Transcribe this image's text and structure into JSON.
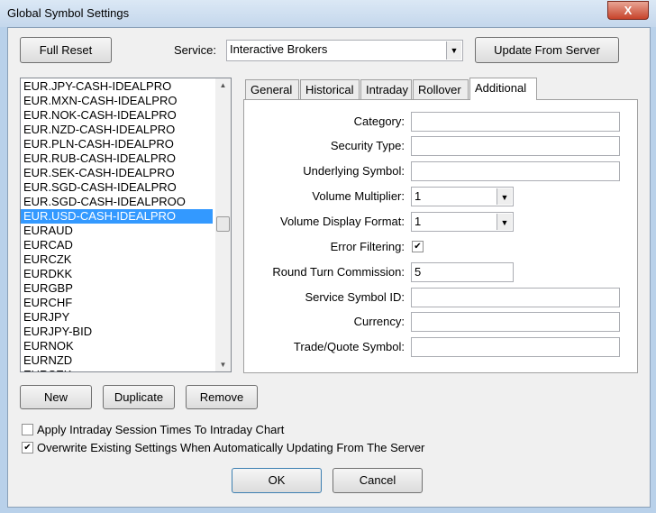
{
  "window": {
    "title": "Global Symbol Settings",
    "close": "X"
  },
  "toolbar": {
    "full_reset": "Full Reset",
    "service_label": "Service:",
    "service_value": "Interactive Brokers",
    "update": "Update From Server"
  },
  "symbols": [
    "EUR.JPY-CASH-IDEALPRO",
    "EUR.MXN-CASH-IDEALPRO",
    "EUR.NOK-CASH-IDEALPRO",
    "EUR.NZD-CASH-IDEALPRO",
    "EUR.PLN-CASH-IDEALPRO",
    "EUR.RUB-CASH-IDEALPRO",
    "EUR.SEK-CASH-IDEALPRO",
    "EUR.SGD-CASH-IDEALPRO",
    "EUR.SGD-CASH-IDEALPROO",
    "EUR.USD-CASH-IDEALPRO",
    "EURAUD",
    "EURCAD",
    "EURCZK",
    "EURDKK",
    "EURGBP",
    "EURCHF",
    "EURJPY",
    "EURJPY-BID",
    "EURNOK",
    "EURNZD",
    "EURSEK"
  ],
  "selected_symbol": "EUR.USD-CASH-IDEALPRO",
  "tabs": [
    "General",
    "Historical",
    "Intraday",
    "Rollover",
    "Additional"
  ],
  "active_tab": "Additional",
  "fields": {
    "category": {
      "label": "Category:",
      "value": ""
    },
    "security_type": {
      "label": "Security Type:",
      "value": ""
    },
    "underlying": {
      "label": "Underlying Symbol:",
      "value": ""
    },
    "volume_multiplier": {
      "label": "Volume Multiplier:",
      "value": "1"
    },
    "volume_format": {
      "label": "Volume Display Format:",
      "value": "1"
    },
    "error_filtering": {
      "label": "Error Filtering:",
      "checked": true
    },
    "commission": {
      "label": "Round Turn Commission:",
      "value": "5"
    },
    "service_symbol_id": {
      "label": "Service Symbol ID:",
      "value": ""
    },
    "currency": {
      "label": "Currency:",
      "value": ""
    },
    "trade_quote": {
      "label": "Trade/Quote Symbol:",
      "value": ""
    }
  },
  "list_buttons": {
    "new": "New",
    "duplicate": "Duplicate",
    "remove": "Remove"
  },
  "options": {
    "apply_intraday": {
      "label": "Apply Intraday Session Times To Intraday Chart",
      "checked": false
    },
    "overwrite": {
      "label": "Overwrite Existing Settings When Automatically Updating From The Server",
      "checked": true
    }
  },
  "footer": {
    "ok": "OK",
    "cancel": "Cancel"
  }
}
